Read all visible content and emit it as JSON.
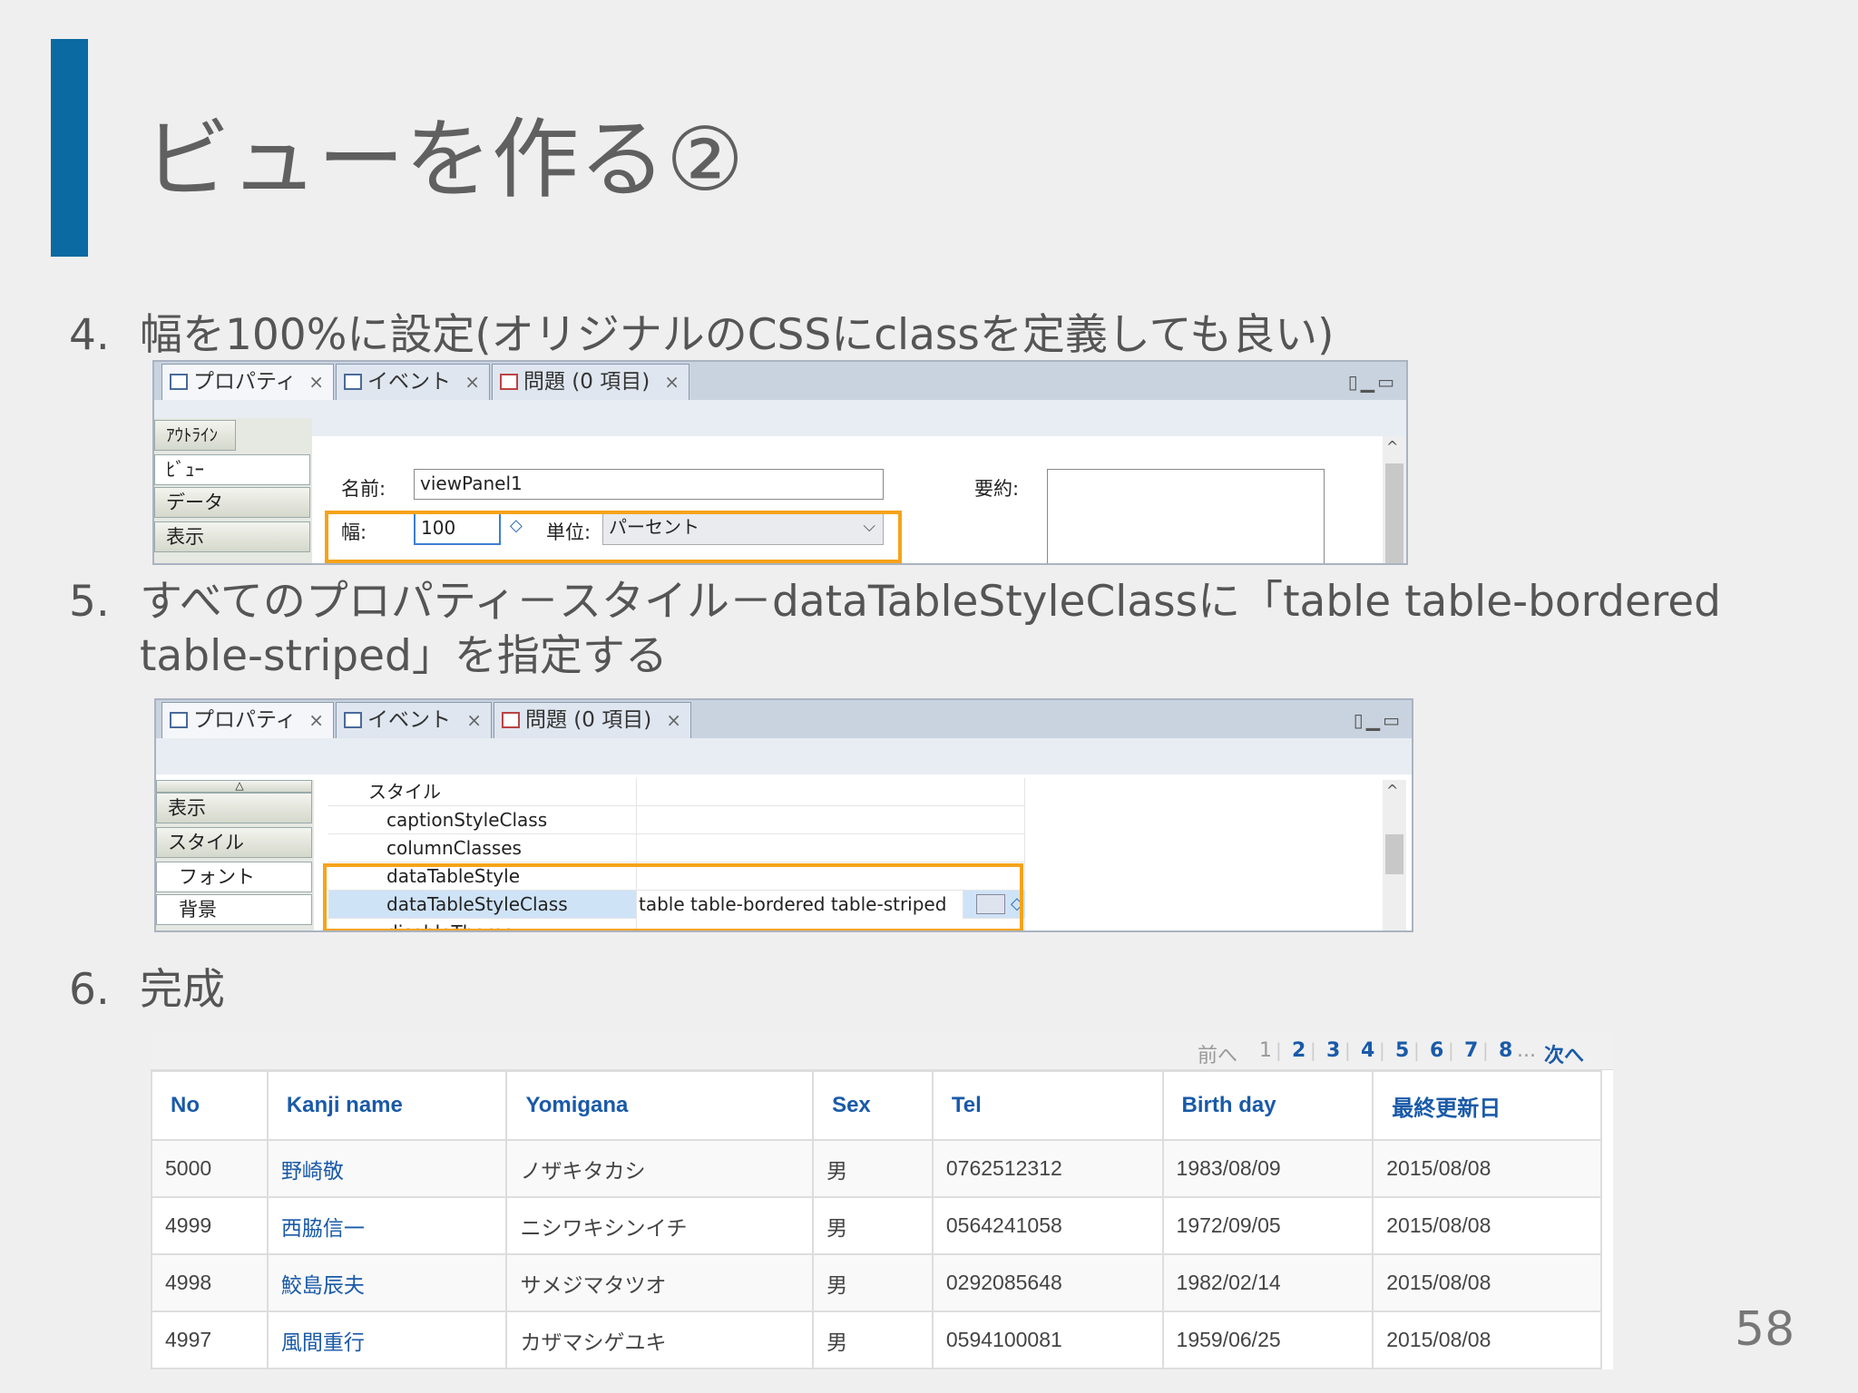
{
  "slide": {
    "title": "ビューを作る②",
    "page_number": "58",
    "accent_color": "#0a6aa1",
    "highlight_color": "#f5a31a"
  },
  "steps": [
    {
      "num": "4.",
      "text": "幅を100%に設定(オリジナルのCSSにclassを定義しても良い)"
    },
    {
      "num": "5.",
      "text": "すべてのプロパティ－スタイル－dataTableStyleClassに「table table-bordered",
      "text2": "table-striped」を指定する"
    },
    {
      "num": "6.",
      "text": "完成"
    }
  ],
  "panel1": {
    "tabs": [
      "プロパティ",
      "イベント",
      "問題 (0 項目)"
    ],
    "close": "×",
    "outline_label": "ｱｳﾄﾗｲﾝ",
    "side_items": [
      "ﾋﾞｭｰ",
      "データ",
      "表示"
    ],
    "name_label": "名前:",
    "name_value": "viewPanel1",
    "summary_label": "要約:",
    "width_label": "幅:",
    "width_value": "100",
    "unit_label": "単位:",
    "unit_value": "パーセント"
  },
  "panel2": {
    "tabs": [
      "プロパティ",
      "イベント",
      "問題 (0 項目)"
    ],
    "close": "×",
    "side_items": [
      "表示",
      "スタイル",
      "フォント",
      "背景"
    ],
    "section": "スタイル",
    "rows": [
      {
        "name": "captionStyleClass",
        "value": ""
      },
      {
        "name": "columnClasses",
        "value": ""
      },
      {
        "name": "dataTableStyle",
        "value": ""
      },
      {
        "name": "dataTableStyleClass",
        "value": "table table-bordered table-striped"
      },
      {
        "name": "disableTheme",
        "value": ""
      }
    ]
  },
  "result": {
    "pager": {
      "prev": "前へ",
      "pages": [
        "1",
        "2",
        "3",
        "4",
        "5",
        "6",
        "7",
        "8"
      ],
      "ellipsis": "...",
      "next": "次へ"
    },
    "columns": [
      "No",
      "Kanji name",
      "Yomigana",
      "Sex",
      "Tel",
      "Birth day",
      "最終更新日"
    ],
    "rows": [
      [
        "5000",
        "野崎敬",
        "ノザキタカシ",
        "男",
        "0762512312",
        "1983/08/09",
        "2015/08/08"
      ],
      [
        "4999",
        "西脇信一",
        "ニシワキシンイチ",
        "男",
        "0564241058",
        "1972/09/05",
        "2015/08/08"
      ],
      [
        "4998",
        "鮫島辰夫",
        "サメジマタツオ",
        "男",
        "0292085648",
        "1982/02/14",
        "2015/08/08"
      ],
      [
        "4997",
        "風間重行",
        "カザマシゲユキ",
        "男",
        "0594100081",
        "1959/06/25",
        "2015/08/08"
      ]
    ]
  }
}
